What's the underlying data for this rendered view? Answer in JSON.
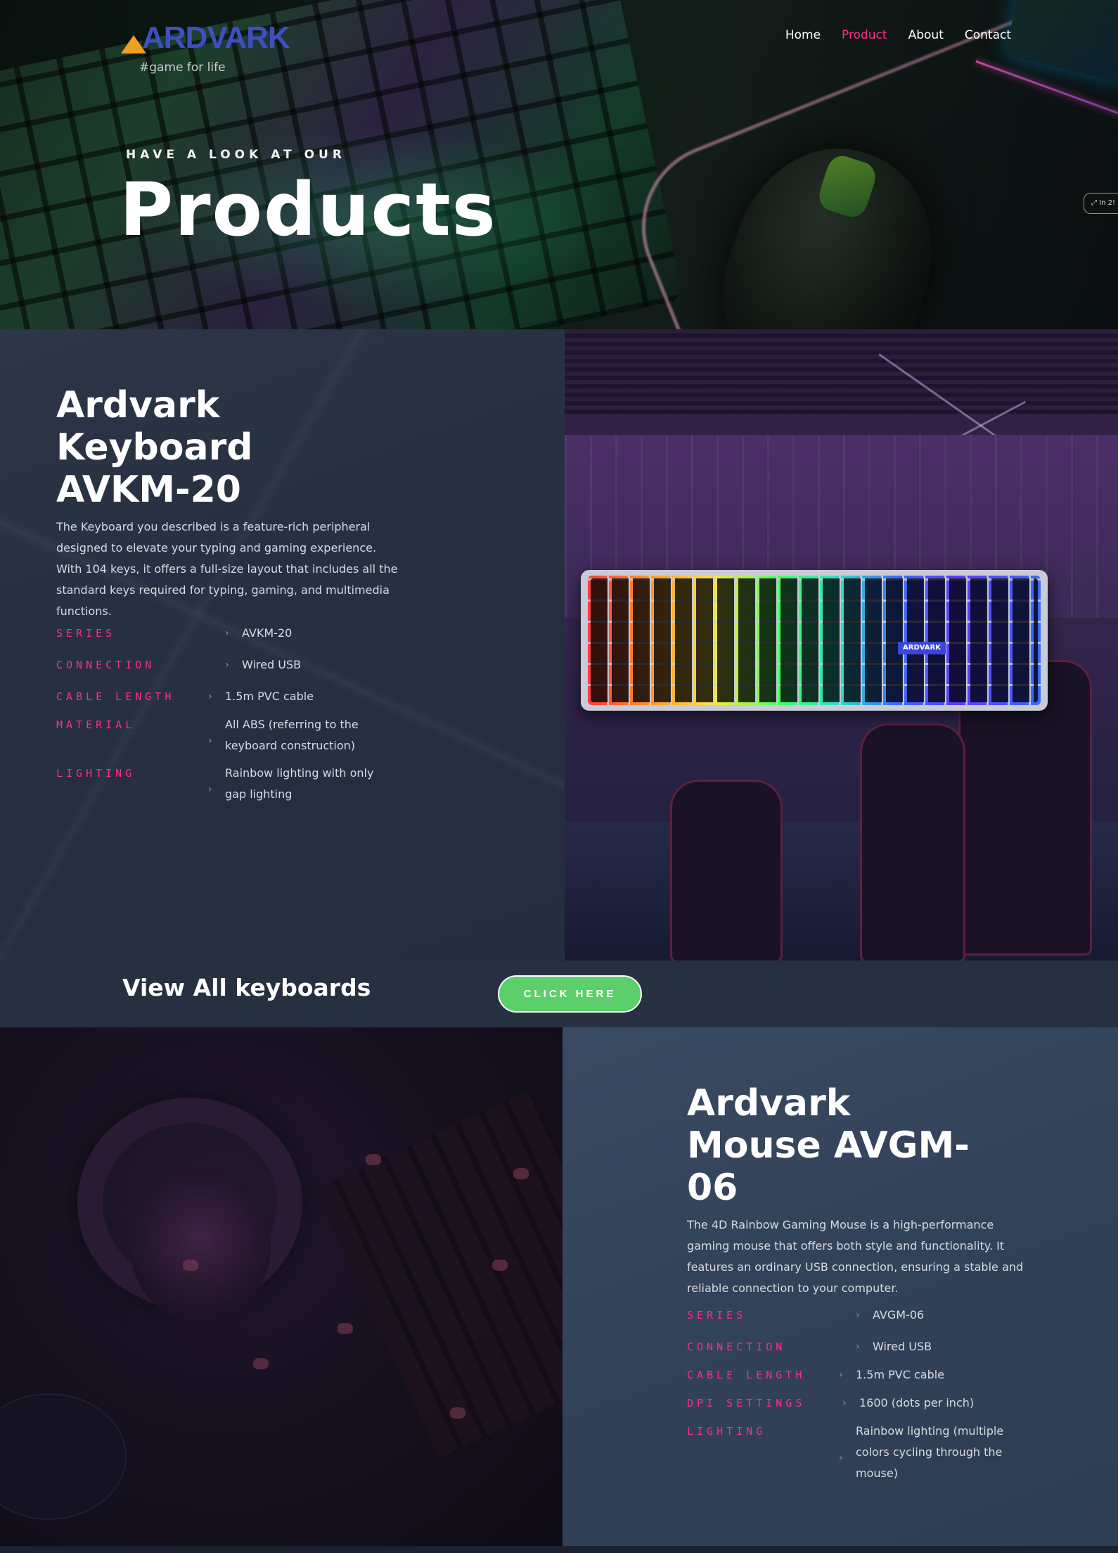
{
  "brand": {
    "logo": "ARDVARK",
    "tagline": "#game for life"
  },
  "nav": [
    {
      "label": "Home",
      "active": false
    },
    {
      "label": "Product",
      "active": true
    },
    {
      "label": "About",
      "active": false
    },
    {
      "label": "Contact",
      "active": false
    }
  ],
  "hero": {
    "subtitle": "HAVE A LOOK AT OUR",
    "title": "Products",
    "side_tab": "In 2!"
  },
  "keyboard": {
    "title_lines": [
      "Ardvark",
      "Keyboard",
      "AVKM-20"
    ],
    "description": "The Keyboard you described is a feature-rich peripheral designed to elevate your typing and gaming experience. With 104 keys, it offers a full-size layout that includes all the standard keys required for typing, gaming, and multimedia functions.",
    "desc_lines": [
      "The Keyboard you described is a feature-rich peripheral",
      "designed to elevate your typing and gaming experience.",
      "With 104 keys, it offers a full-size layout that includes all the",
      "standard keys required for typing, gaming, and multimedia",
      "functions."
    ],
    "specs": [
      {
        "label": "SERIES",
        "value_lines": [
          "AVKM-20"
        ]
      },
      {
        "label": "CONNECTION",
        "value_lines": [
          "Wired USB"
        ]
      },
      {
        "label": "CABLE LENGTH",
        "value_lines": [
          "1.5m PVC cable"
        ]
      },
      {
        "label": "MATERIAL",
        "value_lines": [
          "All ABS (referring to the",
          "keyboard construction)"
        ]
      },
      {
        "label": "LIGHTING",
        "value_lines": [
          "Rainbow lighting with only",
          "gap lighting"
        ]
      }
    ],
    "keycap_brand": "ARDVARK"
  },
  "view_all": {
    "title": "View All keyboards",
    "button": "CLICK HERE"
  },
  "mouse": {
    "title_lines": [
      "Ardvark",
      "Mouse AVGM-",
      "06"
    ],
    "desc_lines": [
      "The 4D Rainbow Gaming Mouse is a high-performance",
      "gaming mouse that offers both style and functionality. It",
      "features an ordinary USB connection, ensuring a stable and",
      "reliable connection to your computer."
    ],
    "specs": [
      {
        "label": "SERIES",
        "value_lines": [
          "AVGM-06"
        ]
      },
      {
        "label": "CONNECTION",
        "value_lines": [
          "Wired USB"
        ]
      },
      {
        "label": "CABLE LENGTH",
        "value_lines": [
          "1.5m PVC cable"
        ]
      },
      {
        "label": "DPI SETTINGS",
        "value_lines": [
          "1600 (dots per inch)"
        ]
      },
      {
        "label": "LIGHTING",
        "value_lines": [
          "Rainbow lighting (multiple",
          "colors cycling through the",
          "mouse)"
        ]
      }
    ]
  },
  "colors": {
    "accent": "#ff2d8a",
    "cta": "#5ccf6a",
    "logo": "#3f4fbf",
    "panel": "#263041"
  },
  "icons": {
    "spec_chevron": "chevron-right-icon",
    "logo_mark": "aardvark-logo-icon"
  }
}
